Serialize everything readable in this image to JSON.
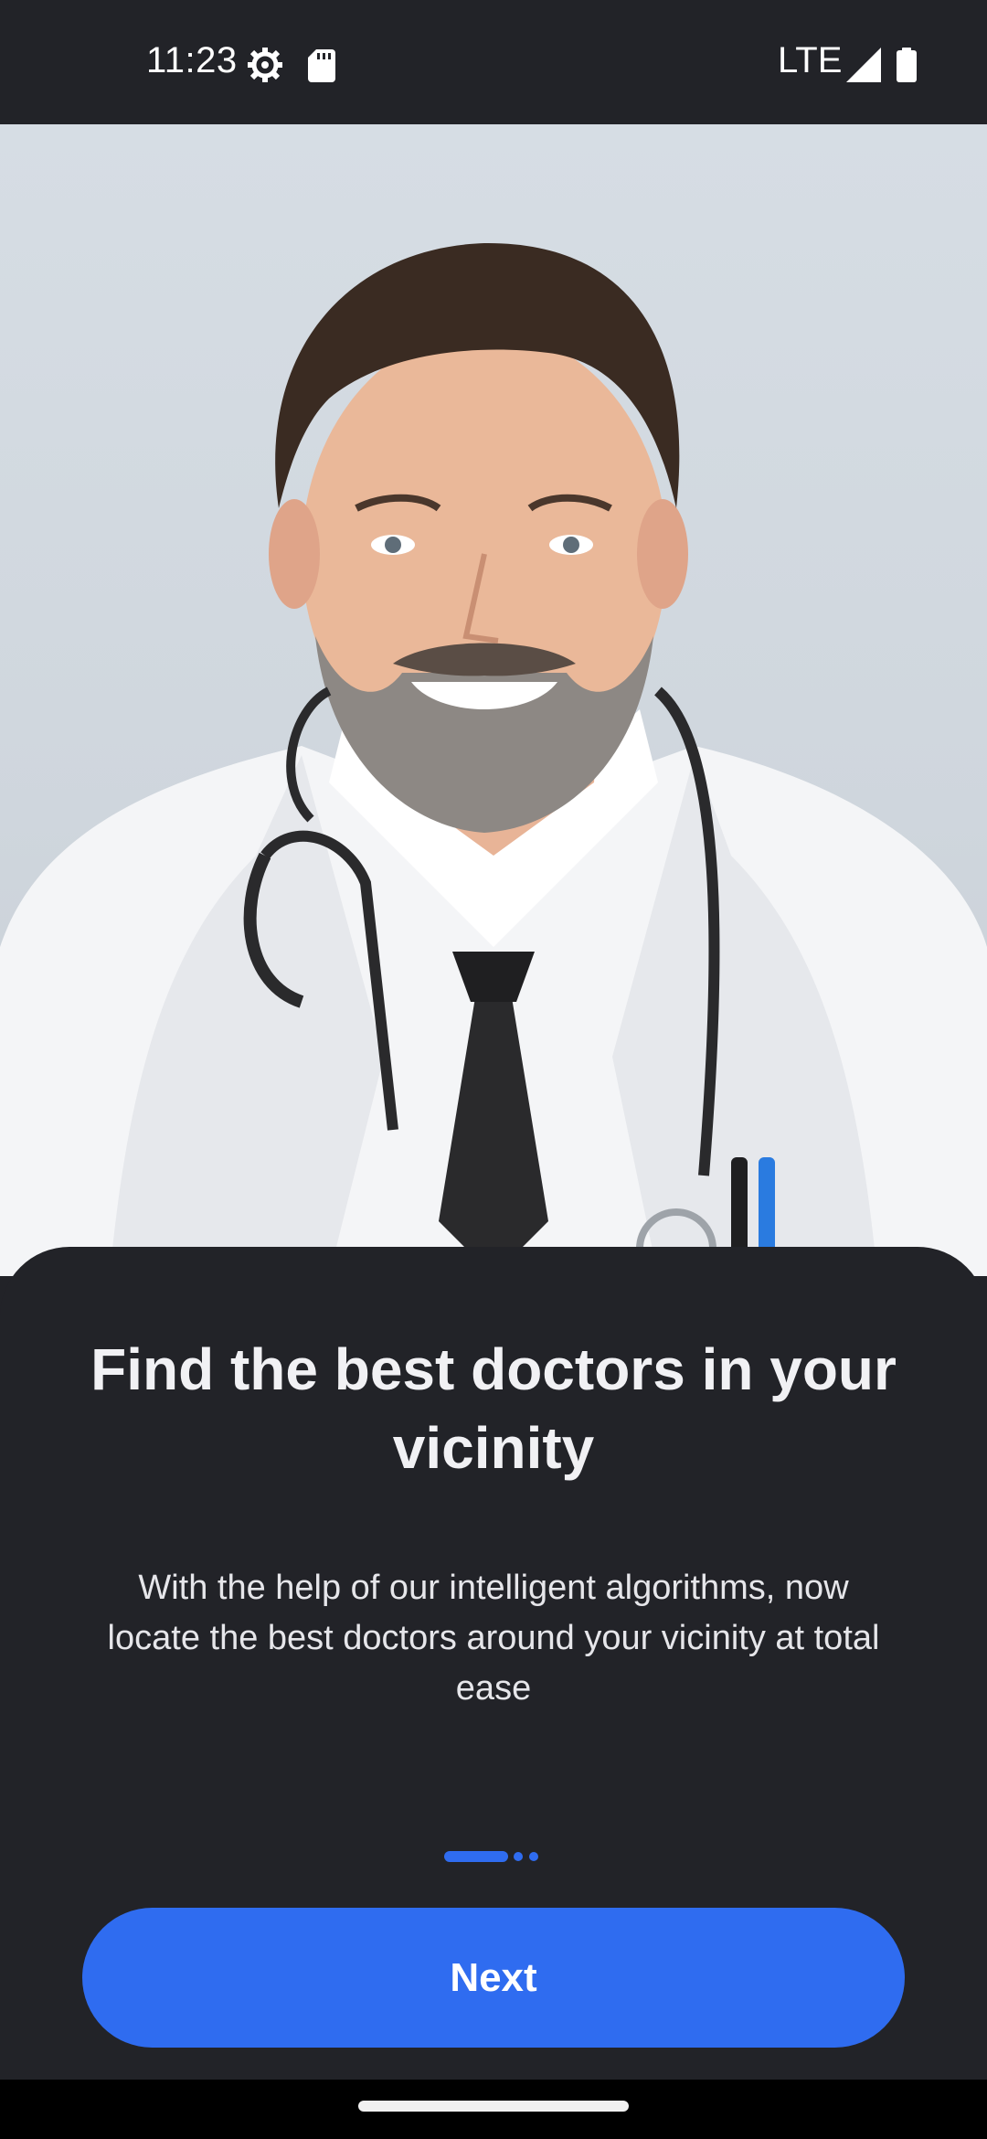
{
  "status_bar": {
    "time": "11:23",
    "network": "LTE",
    "icons": [
      "settings-gear-icon",
      "sd-card-icon",
      "signal-icon",
      "battery-icon"
    ]
  },
  "hero": {
    "image": "smiling-doctor-photo"
  },
  "onboarding": {
    "title": "Find the best doctors in your vicinity",
    "description": "With the help of our intelligent algorithms, now locate the best doctors around your vicinity at total ease",
    "page_indicator": {
      "current": 1,
      "total": 3
    },
    "next_label": "Next"
  },
  "colors": {
    "accent": "#2F6CF0",
    "background": "#222328",
    "hero_background": "#D6DDE4"
  }
}
